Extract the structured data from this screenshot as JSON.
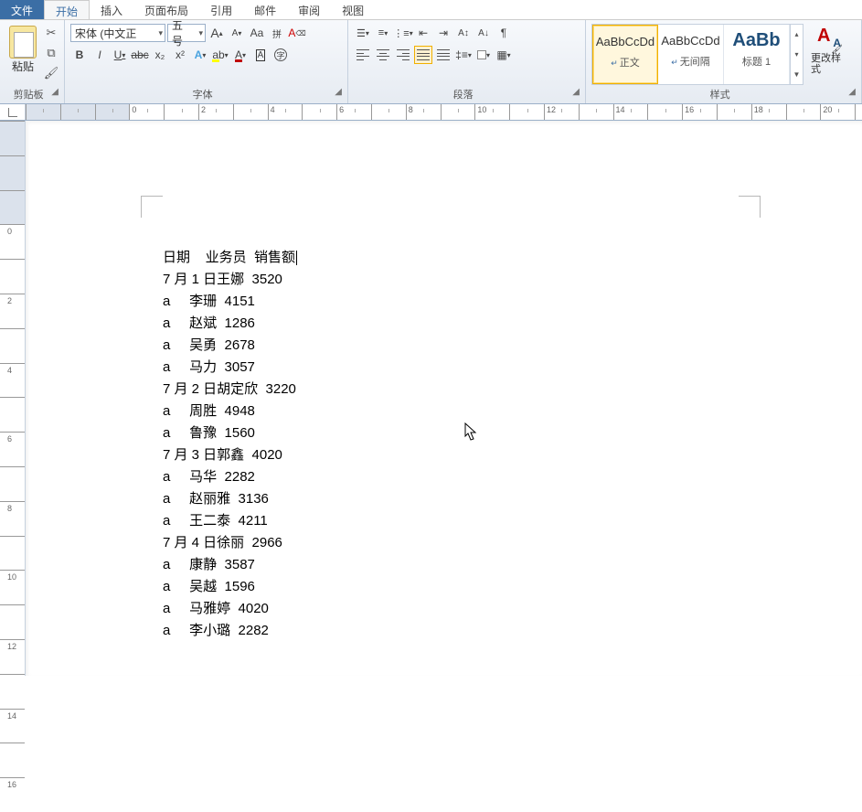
{
  "tabs": {
    "file": "文件",
    "home": "开始",
    "insert": "插入",
    "layout": "页面布局",
    "references": "引用",
    "mailings": "邮件",
    "review": "审阅",
    "view": "视图"
  },
  "clipboard": {
    "paste": "粘贴",
    "group": "剪贴板"
  },
  "font": {
    "name": "宋体 (中文正",
    "size": "五号",
    "group": "字体",
    "bold": "B",
    "italic": "I",
    "underline": "U",
    "strike": "abc",
    "sub": "x₂",
    "sup": "x²",
    "grow": "A",
    "shrink": "A",
    "case": "Aa",
    "phonetic": "拼",
    "clear": "A",
    "effects": "A",
    "highlight": "ab",
    "color": "A",
    "box": "A",
    "circled": "字"
  },
  "paragraph": {
    "group": "段落"
  },
  "styles": {
    "group": "样式",
    "preview": "AaBbCcDd",
    "preview_big": "AaBb",
    "normal": "正文",
    "nospacing": "无间隔",
    "heading1": "标题 1",
    "change": "更改样式"
  },
  "doc": {
    "headers": {
      "c1": "日期",
      "c2": "业务员",
      "c3": "销售额"
    },
    "rows": [
      {
        "c1": "7 月 1 日",
        "c2": "王娜",
        "c3": "3520"
      },
      {
        "c1": "a",
        "c2": "李珊",
        "c3": "4151"
      },
      {
        "c1": "a",
        "c2": "赵斌",
        "c3": "1286"
      },
      {
        "c1": "a",
        "c2": "吴勇",
        "c3": "2678"
      },
      {
        "c1": "a",
        "c2": "马力",
        "c3": "3057"
      },
      {
        "c1": "7 月 2 日",
        "c2": "胡定欣",
        "c3": "3220"
      },
      {
        "c1": "a",
        "c2": "周胜",
        "c3": "4948"
      },
      {
        "c1": "a",
        "c2": "鲁豫",
        "c3": "1560"
      },
      {
        "c1": "7 月 3 日",
        "c2": "郭鑫",
        "c3": "4020"
      },
      {
        "c1": "a",
        "c2": "马华",
        "c3": "2282"
      },
      {
        "c1": "a",
        "c2": "赵丽雅",
        "c3": "3136"
      },
      {
        "c1": "a",
        "c2": "王二泰",
        "c3": "4211"
      },
      {
        "c1": "7 月 4 日",
        "c2": "徐丽",
        "c3": "2966"
      },
      {
        "c1": "a",
        "c2": "康静",
        "c3": "3587"
      },
      {
        "c1": "a",
        "c2": "吴越",
        "c3": "1596"
      },
      {
        "c1": "a",
        "c2": "马雅婷",
        "c3": "4020"
      },
      {
        "c1": "a",
        "c2": "李小璐",
        "c3": "2282"
      }
    ]
  }
}
